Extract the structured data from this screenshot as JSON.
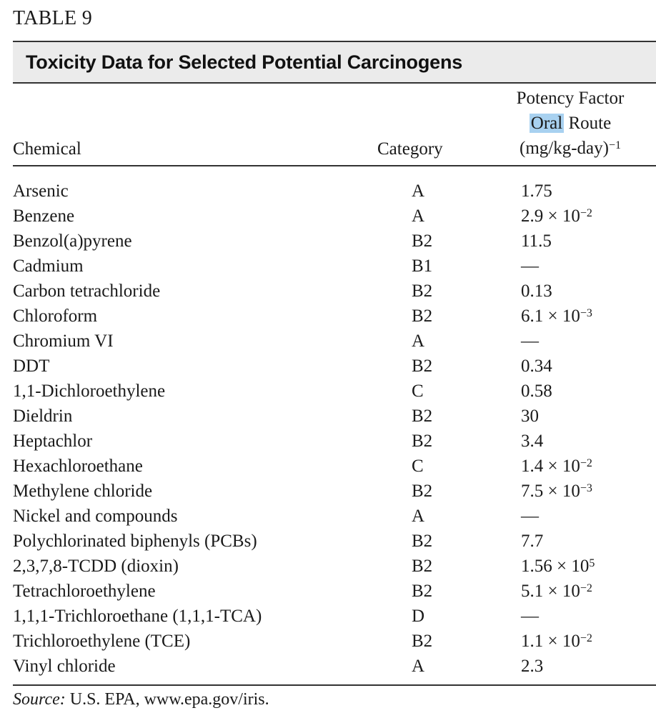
{
  "table_label": "TABLE 9",
  "title": "Toxicity Data for Selected Potential Carcinogens",
  "highlight_color": "#a8d1f0",
  "title_bar_color": "#ebebeb",
  "columns": {
    "chemical": "Chemical",
    "category": "Category",
    "potency_line1": "Potency Factor",
    "potency_line2_highlighted": "Oral",
    "potency_line2_rest": "Route",
    "potency_line3_base": "(mg/kg-day)",
    "potency_line3_exp": "−1"
  },
  "rows": [
    {
      "chemical": "Arsenic",
      "category": "A",
      "potency": "1.75",
      "exp": null
    },
    {
      "chemical": "Benzene",
      "category": "A",
      "potency": "2.9 × 10",
      "exp": "−2"
    },
    {
      "chemical": "Benzol(a)pyrene",
      "category": "B2",
      "potency": "11.5",
      "exp": null
    },
    {
      "chemical": "Cadmium",
      "category": "B1",
      "potency": "—",
      "exp": null
    },
    {
      "chemical": "Carbon tetrachloride",
      "category": "B2",
      "potency": "0.13",
      "exp": null
    },
    {
      "chemical": "Chloroform",
      "category": "B2",
      "potency": "6.1 × 10",
      "exp": "−3"
    },
    {
      "chemical": "Chromium VI",
      "category": "A",
      "potency": "—",
      "exp": null
    },
    {
      "chemical": "DDT",
      "category": "B2",
      "potency": "0.34",
      "exp": null
    },
    {
      "chemical": "1,1-Dichloroethylene",
      "category": "C",
      "potency": "0.58",
      "exp": null
    },
    {
      "chemical": "Dieldrin",
      "category": "B2",
      "potency": "30",
      "exp": null
    },
    {
      "chemical": "Heptachlor",
      "category": "B2",
      "potency": "3.4",
      "exp": null
    },
    {
      "chemical": "Hexachloroethane",
      "category": "C",
      "potency": "1.4 × 10",
      "exp": "−2"
    },
    {
      "chemical": "Methylene chloride",
      "category": "B2",
      "potency": "7.5 × 10",
      "exp": "−3"
    },
    {
      "chemical": "Nickel and compounds",
      "category": "A",
      "potency": "—",
      "exp": null
    },
    {
      "chemical": "Polychlorinated biphenyls (PCBs)",
      "category": "B2",
      "potency": "7.7",
      "exp": null
    },
    {
      "chemical": "2,3,7,8-TCDD (dioxin)",
      "category": "B2",
      "potency": "1.56 × 10",
      "exp": "5"
    },
    {
      "chemical": "Tetrachloroethylene",
      "category": "B2",
      "potency": "5.1 × 10",
      "exp": "−2"
    },
    {
      "chemical": "1,1,1-Trichloroethane (1,1,1-TCA)",
      "category": "D",
      "potency": "—",
      "exp": null
    },
    {
      "chemical": "Trichloroethylene (TCE)",
      "category": "B2",
      "potency": "1.1 × 10",
      "exp": "−2"
    },
    {
      "chemical": "Vinyl chloride",
      "category": "A",
      "potency": "2.3",
      "exp": null
    }
  ],
  "source": {
    "label": "Source:",
    "text": " U.S. EPA, www.epa.gov/iris."
  }
}
